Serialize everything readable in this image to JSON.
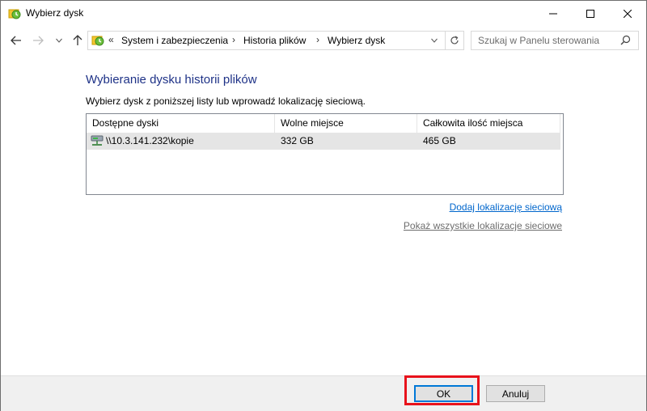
{
  "window": {
    "title": "Wybierz dysk"
  },
  "nav": {
    "back_icon": "arrow-left-icon",
    "forward_icon": "arrow-right-icon",
    "up_icon": "arrow-up-icon",
    "overflow": "«",
    "breadcrumbs": [
      "System i zabezpieczenia",
      "Historia plików",
      "Wybierz dysk"
    ],
    "separator": "›"
  },
  "search": {
    "placeholder": "Szukaj w Panelu sterowania"
  },
  "main": {
    "heading": "Wybieranie dysku historii plików",
    "instructions": "Wybierz dysk z poniższej listy lub wprowadź lokalizację sieciową.",
    "table": {
      "columns": [
        "Dostępne dyski",
        "Wolne miejsce",
        "Całkowita ilość miejsca"
      ],
      "rows": [
        {
          "name": "\\\\10.3.141.232\\kopie",
          "free": "332 GB",
          "total": "465 GB",
          "icon": "network-drive-icon",
          "selected": true
        }
      ]
    },
    "links": {
      "add_network": "Dodaj lokalizację sieciową",
      "show_all": "Pokaż wszystkie lokalizacje sieciowe"
    }
  },
  "footer": {
    "ok_label": "OK",
    "cancel_label": "Anuluj"
  },
  "colors": {
    "heading": "#1e3287",
    "link": "#0066cc",
    "highlight_border": "#e8121b",
    "selected_row": "#e5e5e5"
  }
}
